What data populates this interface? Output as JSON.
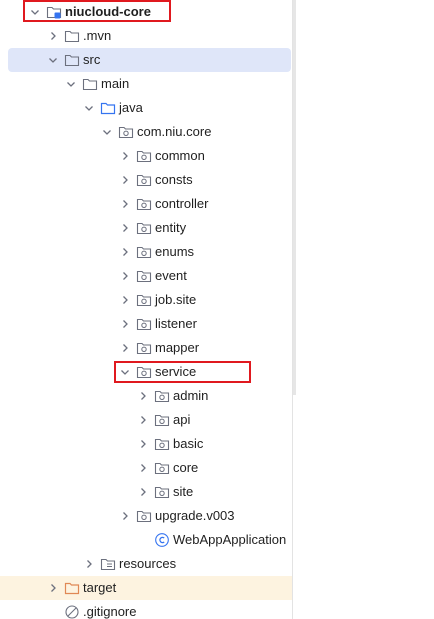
{
  "tree": {
    "items": [
      {
        "label": "niucloud-core",
        "icon": "module-folder-icon",
        "expanded": true
      },
      {
        "label": ".mvn",
        "icon": "folder-icon",
        "expanded": false
      },
      {
        "label": "src",
        "icon": "folder-icon",
        "expanded": true,
        "selected": true
      },
      {
        "label": "main",
        "icon": "folder-icon",
        "expanded": true
      },
      {
        "label": "java",
        "icon": "source-folder-icon",
        "expanded": true
      },
      {
        "label": "com.niu.core",
        "icon": "package-icon",
        "expanded": true
      },
      {
        "label": "common",
        "icon": "package-icon",
        "expanded": false
      },
      {
        "label": "consts",
        "icon": "package-icon",
        "expanded": false
      },
      {
        "label": "controller",
        "icon": "package-icon",
        "expanded": false
      },
      {
        "label": "entity",
        "icon": "package-icon",
        "expanded": false
      },
      {
        "label": "enums",
        "icon": "package-icon",
        "expanded": false
      },
      {
        "label": "event",
        "icon": "package-icon",
        "expanded": false
      },
      {
        "label": "job.site",
        "icon": "package-icon",
        "expanded": false
      },
      {
        "label": "listener",
        "icon": "package-icon",
        "expanded": false
      },
      {
        "label": "mapper",
        "icon": "package-icon",
        "expanded": false
      },
      {
        "label": "service",
        "icon": "package-icon",
        "expanded": true
      },
      {
        "label": "admin",
        "icon": "package-icon",
        "expanded": false
      },
      {
        "label": "api",
        "icon": "package-icon",
        "expanded": false
      },
      {
        "label": "basic",
        "icon": "package-icon",
        "expanded": false
      },
      {
        "label": "core",
        "icon": "package-icon",
        "expanded": false
      },
      {
        "label": "site",
        "icon": "package-icon",
        "expanded": false
      },
      {
        "label": "upgrade.v003",
        "icon": "package-icon",
        "expanded": false
      },
      {
        "label": "WebAppApplication",
        "icon": "class-icon"
      },
      {
        "label": "resources",
        "icon": "resources-folder-icon",
        "expanded": false
      },
      {
        "label": "target",
        "icon": "excluded-folder-icon",
        "expanded": false,
        "excluded": true
      },
      {
        "label": ".gitignore",
        "icon": "ignored-file-icon"
      }
    ]
  },
  "colors": {
    "selection": "#dfe6f9",
    "excluded_row": "#fdf3e0",
    "highlight_box": "#e0191f",
    "folder_stroke": "#6c707e",
    "source_folder": "#3574f0",
    "excluded_folder": "#e08855",
    "class_icon": "#3574f0"
  }
}
